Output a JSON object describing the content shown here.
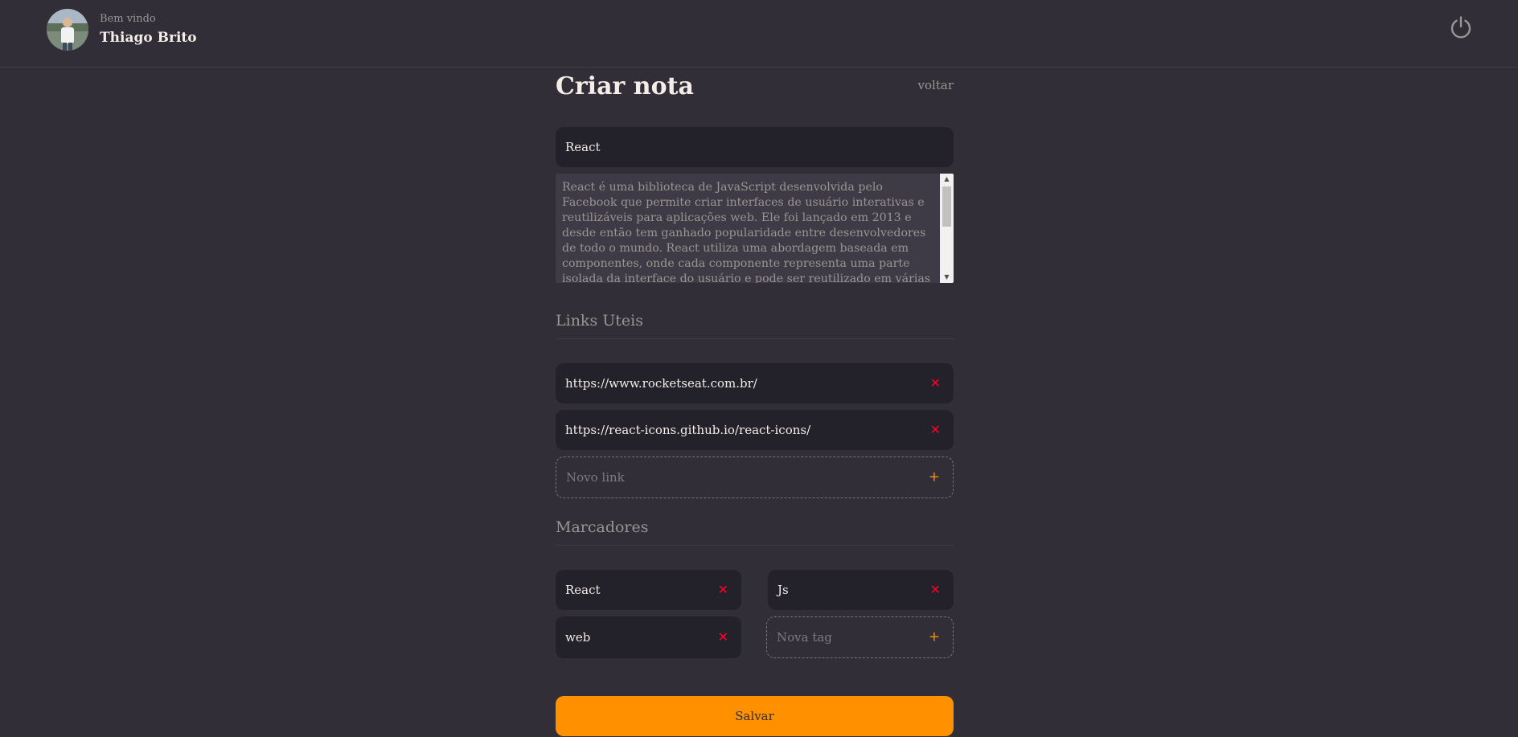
{
  "header": {
    "welcome": "Bem vindo",
    "username": "Thiago Brito",
    "logout_icon": "power-icon"
  },
  "form": {
    "title": "Criar nota",
    "back_label": "voltar",
    "title_value": "React",
    "description": "React é uma biblioteca de JavaScript desenvolvida pelo Facebook que permite criar interfaces de usuário interativas e reutilizáveis para aplicações web. Ele foi lançado em 2013 e desde então tem ganhado popularidade entre desenvolvedores de todo o mundo. React utiliza uma abordagem baseada em componentes, onde cada componente representa uma parte isolada da interface do usuário e pode ser reutilizado em várias partes do aplicativo. Isso torna o"
  },
  "links": {
    "section_title": "Links Uteis",
    "items": [
      {
        "url": "https://www.rocketseat.com.br/"
      },
      {
        "url": "https://react-icons.github.io/react-icons/"
      }
    ],
    "new_placeholder": "Novo link"
  },
  "tags": {
    "section_title": "Marcadores",
    "items": [
      {
        "label": "React"
      },
      {
        "label": "Js"
      },
      {
        "label": "web"
      }
    ],
    "new_placeholder": "Nova tag"
  },
  "actions": {
    "save_label": "Salvar"
  },
  "colors": {
    "background": "#312e38",
    "input_bg": "#232129",
    "accent": "#ff9000",
    "remove": "#ff002e",
    "muted_text": "#999591"
  }
}
